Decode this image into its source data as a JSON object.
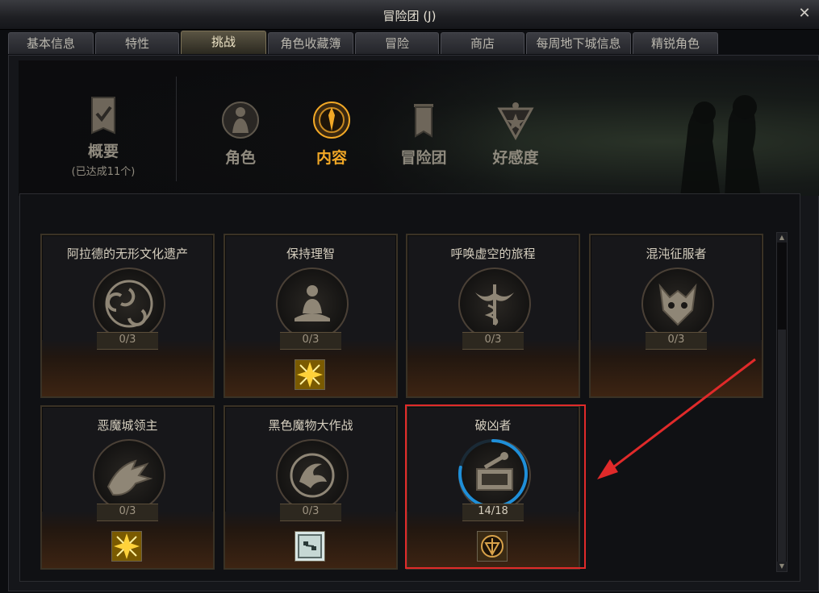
{
  "window": {
    "title": "冒险团 (J)",
    "close": "✕"
  },
  "tabs": [
    "基本信息",
    "特性",
    "挑战",
    "角色收藏簿",
    "冒险",
    "商店",
    "每周地下城信息",
    "精锐角色"
  ],
  "active_tab": "挑战",
  "nav": {
    "overview": {
      "label": "概要",
      "sub": "(已达成11个)"
    },
    "items": [
      "角色",
      "内容",
      "冒险团",
      "好感度"
    ],
    "active": "内容"
  },
  "cards": [
    {
      "title": "阿拉德的无形文化遗产",
      "progress": "0/3",
      "icon": "triskelion-icon",
      "reward": false
    },
    {
      "title": "保持理智",
      "progress": "0/3",
      "icon": "meditation-icon",
      "reward": "star-reward-icon"
    },
    {
      "title": "呼唤虚空的旅程",
      "progress": "0/3",
      "icon": "caduceus-icon",
      "reward": false
    },
    {
      "title": "混沌征服者",
      "progress": "0/3",
      "icon": "demon-mask-icon",
      "reward": false
    },
    {
      "title": "恶魔城领主",
      "progress": "0/3",
      "icon": "dragon-icon",
      "reward": "star-reward-icon"
    },
    {
      "title": "黑色魔物大作战",
      "progress": "0/3",
      "icon": "phoenix-icon",
      "reward": "map-reward-icon"
    },
    {
      "title": "破凶者",
      "progress": "14/18",
      "icon": "forge-icon",
      "reward": "emblem-reward-icon",
      "progress_fraction": 0.78
    }
  ],
  "colors": {
    "accent": "#f2a826",
    "highlight": "#e02a2a",
    "progress_ring": "#1f8fd8"
  }
}
